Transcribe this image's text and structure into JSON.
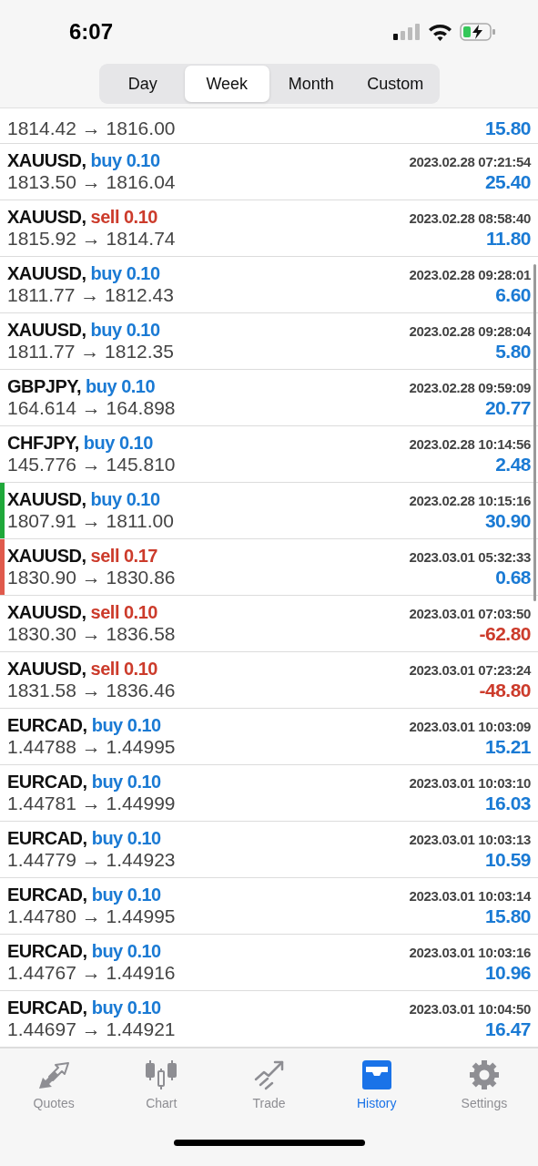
{
  "status_bar": {
    "time": "6:07"
  },
  "period_tabs": [
    {
      "label": "Day",
      "selected": false
    },
    {
      "label": "Week",
      "selected": true
    },
    {
      "label": "Month",
      "selected": false
    },
    {
      "label": "Custom",
      "selected": false
    }
  ],
  "partial_row": {
    "prices": "1814.42 → 1816.00",
    "profit": "15.80",
    "loss": false
  },
  "deals": [
    {
      "symbol": "XAUUSD,",
      "order": "buy 0.10",
      "kind": "buy",
      "time": "2023.02.28 07:21:54",
      "prices": "1813.50 → 1816.04",
      "profit": "25.40",
      "loss": false
    },
    {
      "symbol": "XAUUSD,",
      "order": "sell 0.10",
      "kind": "sell",
      "time": "2023.02.28 08:58:40",
      "prices": "1815.92 → 1814.74",
      "profit": "11.80",
      "loss": false
    },
    {
      "symbol": "XAUUSD,",
      "order": "buy 0.10",
      "kind": "buy",
      "time": "2023.02.28 09:28:01",
      "prices": "1811.77 → 1812.43",
      "profit": "6.60",
      "loss": false
    },
    {
      "symbol": "XAUUSD,",
      "order": "buy 0.10",
      "kind": "buy",
      "time": "2023.02.28 09:28:04",
      "prices": "1811.77 → 1812.35",
      "profit": "5.80",
      "loss": false
    },
    {
      "symbol": "GBPJPY,",
      "order": "buy 0.10",
      "kind": "buy",
      "time": "2023.02.28 09:59:09",
      "prices": "164.614 → 164.898",
      "profit": "20.77",
      "loss": false
    },
    {
      "symbol": "CHFJPY,",
      "order": "buy 0.10",
      "kind": "buy",
      "time": "2023.02.28 10:14:56",
      "prices": "145.776 → 145.810",
      "profit": "2.48",
      "loss": false
    },
    {
      "symbol": "XAUUSD,",
      "order": "buy 0.10",
      "kind": "buy",
      "time": "2023.02.28 10:15:16",
      "prices": "1807.91 → 1811.00",
      "profit": "30.90",
      "loss": false,
      "color": "#1fa83a"
    },
    {
      "symbol": "XAUUSD,",
      "order": "sell 0.17",
      "kind": "sell",
      "time": "2023.03.01 05:32:33",
      "prices": "1830.90 → 1830.86",
      "profit": "0.68",
      "loss": false,
      "color": "#e05a4c"
    },
    {
      "symbol": "XAUUSD,",
      "order": "sell 0.10",
      "kind": "sell",
      "time": "2023.03.01 07:03:50",
      "prices": "1830.30 → 1836.58",
      "profit": "-62.80",
      "loss": true
    },
    {
      "symbol": "XAUUSD,",
      "order": "sell 0.10",
      "kind": "sell",
      "time": "2023.03.01 07:23:24",
      "prices": "1831.58 → 1836.46",
      "profit": "-48.80",
      "loss": true
    },
    {
      "symbol": "EURCAD,",
      "order": "buy 0.10",
      "kind": "buy",
      "time": "2023.03.01 10:03:09",
      "prices": "1.44788 → 1.44995",
      "profit": "15.21",
      "loss": false
    },
    {
      "symbol": "EURCAD,",
      "order": "buy 0.10",
      "kind": "buy",
      "time": "2023.03.01 10:03:10",
      "prices": "1.44781 → 1.44999",
      "profit": "16.03",
      "loss": false
    },
    {
      "symbol": "EURCAD,",
      "order": "buy 0.10",
      "kind": "buy",
      "time": "2023.03.01 10:03:13",
      "prices": "1.44779 → 1.44923",
      "profit": "10.59",
      "loss": false
    },
    {
      "symbol": "EURCAD,",
      "order": "buy 0.10",
      "kind": "buy",
      "time": "2023.03.01 10:03:14",
      "prices": "1.44780 → 1.44995",
      "profit": "15.80",
      "loss": false
    },
    {
      "symbol": "EURCAD,",
      "order": "buy 0.10",
      "kind": "buy",
      "time": "2023.03.01 10:03:16",
      "prices": "1.44767 → 1.44916",
      "profit": "10.96",
      "loss": false
    },
    {
      "symbol": "EURCAD,",
      "order": "buy 0.10",
      "kind": "buy",
      "time": "2023.03.01 10:04:50",
      "prices": "1.44697 → 1.44921",
      "profit": "16.47",
      "loss": false
    }
  ],
  "tab_bar": [
    {
      "label": "Quotes",
      "kind": "quotes",
      "selected": false
    },
    {
      "label": "Chart",
      "kind": "chart",
      "selected": false
    },
    {
      "label": "Trade",
      "kind": "trade",
      "selected": false
    },
    {
      "label": "History",
      "kind": "history",
      "selected": true
    },
    {
      "label": "Settings",
      "kind": "settings",
      "selected": false
    }
  ]
}
